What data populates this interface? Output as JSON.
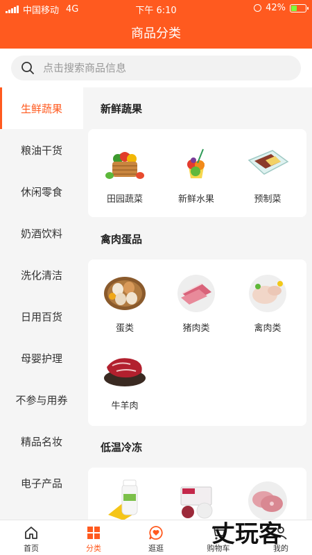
{
  "status_bar": {
    "carrier": "中国移动",
    "network": "4G",
    "time": "下午 6:10",
    "battery": "42%",
    "battery_level": 0.42
  },
  "nav": {
    "title": "商品分类"
  },
  "search": {
    "placeholder": "点击搜索商品信息"
  },
  "sidebar": {
    "items": [
      {
        "label": "生鲜蔬果",
        "active": true
      },
      {
        "label": "粮油干货"
      },
      {
        "label": "休闲零食"
      },
      {
        "label": "奶酒饮料"
      },
      {
        "label": "洗化清洁"
      },
      {
        "label": "日用百货"
      },
      {
        "label": "母婴护理"
      },
      {
        "label": "不参与用券"
      },
      {
        "label": "精品名妆"
      },
      {
        "label": "电子产品"
      }
    ]
  },
  "sections": [
    {
      "title": "新鲜蔬果",
      "items": [
        {
          "label": "田园蔬菜",
          "icon": "vegetable-basket-icon"
        },
        {
          "label": "新鲜水果",
          "icon": "fruit-icon"
        },
        {
          "label": "预制菜",
          "icon": "prepared-meal-icon"
        }
      ]
    },
    {
      "title": "禽肉蛋品",
      "items": [
        {
          "label": "蛋类",
          "icon": "eggs-icon"
        },
        {
          "label": "猪肉类",
          "icon": "pork-icon"
        },
        {
          "label": "禽肉类",
          "icon": "poultry-icon"
        },
        {
          "label": "牛羊肉",
          "icon": "beef-icon"
        }
      ]
    },
    {
      "title": "低温冷冻",
      "items": [
        {
          "label": "",
          "icon": "yogurt-icon"
        },
        {
          "label": "",
          "icon": "frozen-package-icon"
        },
        {
          "label": "",
          "icon": "ham-slices-icon"
        }
      ]
    }
  ],
  "tabbar": {
    "items": [
      {
        "label": "首页",
        "icon": "home-icon"
      },
      {
        "label": "分类",
        "icon": "category-grid-icon",
        "active": true
      },
      {
        "label": "逛逛",
        "icon": "heart-chat-icon"
      },
      {
        "label": "购物车",
        "icon": "cart-icon"
      },
      {
        "label": "我的",
        "icon": "user-icon"
      }
    ]
  },
  "watermark": {
    "text": "丈玩客"
  },
  "colors": {
    "accent": "#ff5a1f",
    "background": "#f5f5f5",
    "card": "#ffffff"
  }
}
